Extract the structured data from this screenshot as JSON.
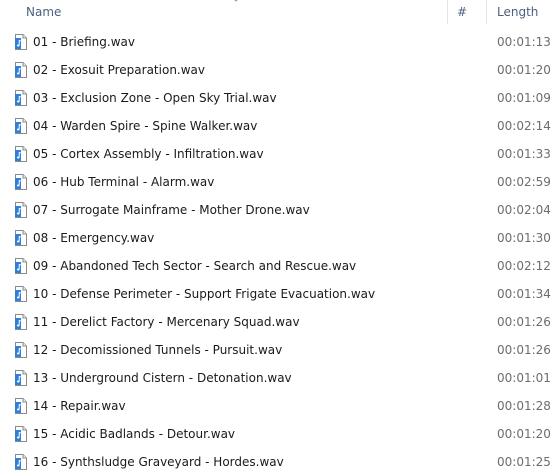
{
  "header": {
    "name_label": "Name",
    "num_label": "#",
    "length_label": "Length"
  },
  "file_icon": "audio-file-icon",
  "rows": [
    {
      "name": "01 - Briefing.wav",
      "length": "00:01:13"
    },
    {
      "name": "02 - Exosuit Preparation.wav",
      "length": "00:01:20"
    },
    {
      "name": "03 - Exclusion Zone - Open Sky Trial.wav",
      "length": "00:01:09"
    },
    {
      "name": "04 - Warden Spire - Spine Walker.wav",
      "length": "00:02:14"
    },
    {
      "name": "05 - Cortex Assembly - Infiltration.wav",
      "length": "00:01:33"
    },
    {
      "name": "06 - Hub Terminal - Alarm.wav",
      "length": "00:02:59"
    },
    {
      "name": "07 - Surrogate Mainframe - Mother Drone.wav",
      "length": "00:02:04"
    },
    {
      "name": "08 - Emergency.wav",
      "length": "00:01:30"
    },
    {
      "name": "09 - Abandoned Tech Sector - Search and Rescue.wav",
      "length": "00:02:12"
    },
    {
      "name": "10 - Defense Perimeter - Support Frigate Evacuation.wav",
      "length": "00:01:34"
    },
    {
      "name": "11 - Derelict Factory - Mercenary Squad.wav",
      "length": "00:01:26"
    },
    {
      "name": "12 - Decomissioned Tunnels - Pursuit.wav",
      "length": "00:01:26"
    },
    {
      "name": "13 - Underground Cistern - Detonation.wav",
      "length": "00:01:01"
    },
    {
      "name": "14 - Repair.wav",
      "length": "00:01:28"
    },
    {
      "name": "15 - Acidic Badlands - Detour.wav",
      "length": "00:01:20"
    },
    {
      "name": "16 - Synthsludge Graveyard - Hordes.wav",
      "length": "00:01:25"
    }
  ]
}
